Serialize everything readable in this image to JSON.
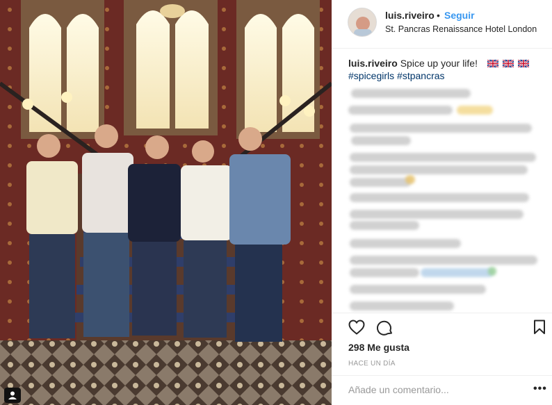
{
  "post": {
    "username": "luis.riveiro",
    "separator": "•",
    "follow_label": "Seguir",
    "location": "St. Pancras Renaissance Hotel London",
    "avatar_alt": "profile picture",
    "caption": {
      "username": "luis.riveiro",
      "text": "Spice up your life!",
      "flag_icon": "uk-flag-icon",
      "flag_count": 3,
      "hashtags": [
        "#spicegirls",
        "#stpancras"
      ]
    },
    "likes_label": "298 Me gusta",
    "time_label": "HACE UN DÍA",
    "comment_placeholder": "Añade un comentario...",
    "more_label": "•••"
  },
  "icons": {
    "like": "heart-icon",
    "comment": "comment-icon",
    "save": "bookmark-icon",
    "tag": "user-tag-icon"
  },
  "colors": {
    "link": "#3897f0",
    "hashtag": "#003569",
    "muted": "#999999",
    "text": "#262626"
  }
}
